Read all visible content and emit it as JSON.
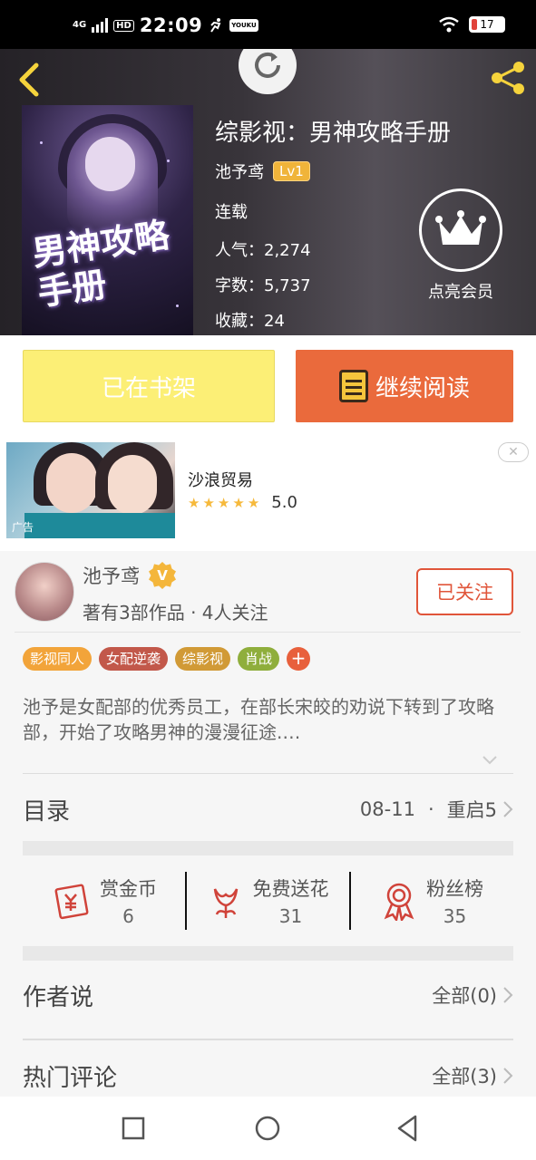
{
  "status_bar": {
    "network": "4G",
    "hd": "HD",
    "time": "22:09",
    "youku": "YOUKU",
    "battery": "17"
  },
  "book": {
    "title": "综影视：男神攻略手册",
    "author": "池予鸢",
    "level": "Lv1",
    "status": "连载",
    "popularity_label": "人气：",
    "popularity": "2,274",
    "words_label": "字数：",
    "words": "5,737",
    "favorites_label": "收藏：",
    "favorites": "24",
    "cover_text": "男神攻略手册"
  },
  "vip": {
    "label": "点亮会员"
  },
  "actions": {
    "shelf_label": "已在书架",
    "read_label": "继续阅读"
  },
  "ad": {
    "name": "沙浪贸易",
    "rating": "5.0",
    "stars": 5,
    "tag": "广告",
    "close": "✕"
  },
  "author_card": {
    "name": "池予鸢",
    "badge": "V",
    "meta": "著有3部作品 · 4人关注",
    "follow_label": "已关注"
  },
  "tags": [
    {
      "label": "影视同人",
      "color": "#f2a43a"
    },
    {
      "label": "女配逆袭",
      "color": "#c2584a"
    },
    {
      "label": "综影视",
      "color": "#d19a36"
    },
    {
      "label": "肖战",
      "color": "#8fae3c"
    }
  ],
  "tag_add": "+",
  "description": "池予是女配部的优秀员工，在部长宋皎的劝说下转到了攻略部，开始了攻略男神的漫漫征途.…",
  "toc": {
    "title": "目录",
    "date": "08-11",
    "latest": "重启5"
  },
  "rewards": [
    {
      "label": "赏金币",
      "value": "6",
      "icon": "coin-envelope-icon"
    },
    {
      "label": "免费送花",
      "value": "31",
      "icon": "flower-icon"
    },
    {
      "label": "粉丝榜",
      "value": "35",
      "icon": "ribbon-medal-icon"
    }
  ],
  "author_says": {
    "title": "作者说",
    "link": "全部(0)"
  },
  "hot_comments": {
    "title": "热门评论",
    "link": "全部(3)"
  },
  "colors": {
    "accent": "#ea6a3c",
    "shelf": "#fcef76",
    "follow": "#e0553a",
    "lv": "#f0b43a"
  }
}
